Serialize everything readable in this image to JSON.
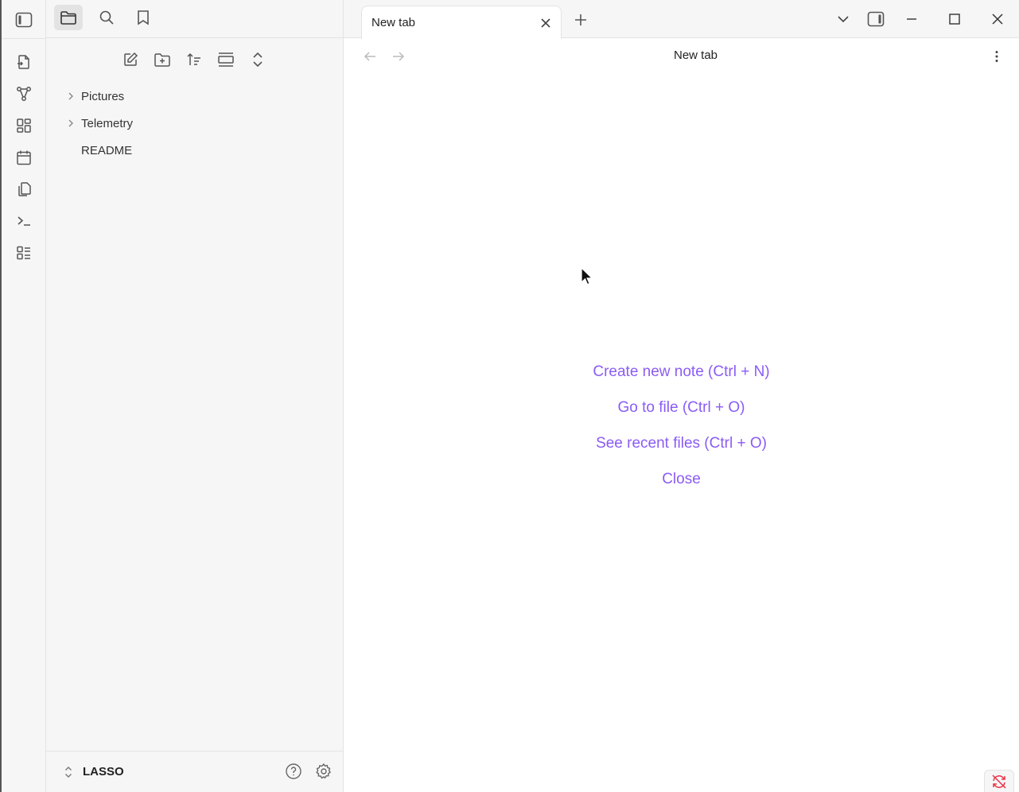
{
  "ribbon": {
    "toggle_sidebar": "sidebar-left-icon",
    "items": [
      {
        "name": "open-quick-switcher",
        "icon": "file-switch-icon"
      },
      {
        "name": "open-graph-view",
        "icon": "graph-icon"
      },
      {
        "name": "open-canvas",
        "icon": "layout-dashboard-icon"
      },
      {
        "name": "open-daily-note",
        "icon": "calendar-icon"
      },
      {
        "name": "insert-template",
        "icon": "files-icon"
      },
      {
        "name": "open-command-palette",
        "icon": "terminal-icon"
      },
      {
        "name": "open-outline",
        "icon": "list-icon"
      }
    ]
  },
  "sidebar": {
    "tabs": [
      {
        "name": "files",
        "icon": "folder-icon",
        "active": true
      },
      {
        "name": "search",
        "icon": "search-icon",
        "active": false
      },
      {
        "name": "bookmarks",
        "icon": "bookmark-icon",
        "active": false
      }
    ],
    "nav_buttons": [
      {
        "name": "new-note",
        "icon": "edit-icon"
      },
      {
        "name": "new-folder",
        "icon": "folder-plus-icon"
      },
      {
        "name": "change-sort-order",
        "icon": "sort-icon"
      },
      {
        "name": "auto-reveal",
        "icon": "reveal-icon"
      },
      {
        "name": "collapse-all",
        "icon": "chevrons-up-down-icon"
      }
    ],
    "tree": [
      {
        "label": "Pictures",
        "folder": true
      },
      {
        "label": "Telemetry",
        "folder": true
      },
      {
        "label": "README",
        "folder": false
      }
    ],
    "vault_name": "LASSO"
  },
  "tabs": [
    {
      "title": "New tab",
      "active": true
    }
  ],
  "view": {
    "title": "New tab"
  },
  "empty_state": {
    "actions": [
      "Create new note (Ctrl + N)",
      "Go to file (Ctrl + O)",
      "See recent files (Ctrl + O)",
      "Close"
    ]
  },
  "colors": {
    "accent": "#8a5cf5",
    "sync_error": "#e93147"
  }
}
